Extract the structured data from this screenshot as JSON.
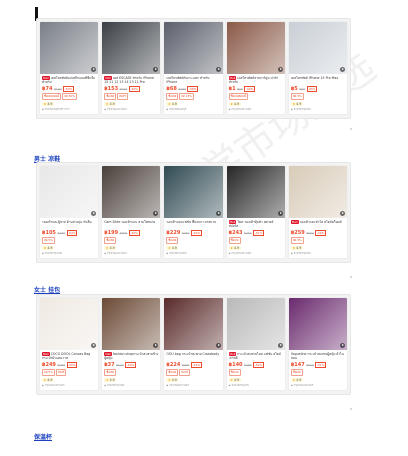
{
  "watermark": "鹏学市场严选",
  "sections": [
    {
      "title": "",
      "items": [
        {
          "title": "เคสโทรศัพท์แม่เหล็กแบบพีซีแข็งสำหรับ",
          "mall": "Mall",
          "price": "฿74",
          "old": "฿199",
          "disc": "-63%",
          "chips": [
            "ซื้อเลยตอนนี้",
            "ลด 50%"
          ],
          "rating": "4.9",
          "location": "จังหวัดสมุทรปราการ",
          "img": "#7a7f87",
          "promo": [
            "orange",
            "red"
          ]
        },
        {
          "title": "เคส ESCASE สำหรับ iPhone 15 11 12 13 14 13 11 Pro",
          "mall": "Mall",
          "price": "฿153",
          "old": "฿299",
          "disc": "-49%",
          "chips": [
            "ซื้อเลย",
            "ส่งฟรี"
          ],
          "rating": "4.9",
          "location": "กรุงเทพมหานคร",
          "img": "#3a3f45",
          "promo": [
            "orange",
            "red"
          ]
        },
        {
          "title": "เคสโทรศัพท์กันกระแทก สำหรับ iPhone",
          "mall": "",
          "price": "฿68",
          "old": "฿160",
          "disc": "-58%",
          "chips": [
            "ซื้อเลย",
            "ลด 15%"
          ],
          "rating": "4.9",
          "location": "จังหวัดนนทบุรี",
          "img": "#5b5f6b",
          "promo": [
            "orange",
            "green"
          ]
        },
        {
          "title": "เคสโทรศัพท์ลายการ์ตูน น่ารัก สำหรับ",
          "mall": "Mall",
          "price": "฿1",
          "old": "฿99",
          "disc": "-99%",
          "chips": [
            "ซื้อเลยตอนนี้"
          ],
          "rating": "4.9",
          "location": "กรุงเทพมหานคร",
          "img": "#8a5a48",
          "promo": [
            "orange",
            "red"
          ]
        },
        {
          "title": "เคสโทรศัพท์ iPhone 15 Pro Max",
          "mall": "",
          "price": "฿5",
          "old": "฿99",
          "disc": "-95%",
          "chips": [
            "ลด 5%"
          ],
          "rating": "4.9",
          "location": "จังหวัดกรุงเทพ",
          "img": "#c9cfd6",
          "promo": [
            "green"
          ]
        }
      ]
    },
    {
      "title": "男士 凉鞋",
      "items": [
        {
          "title": "รองเท้าแตะผู้ชาย ด้านล่างนุ่ม กันลื่น",
          "mall": "",
          "price": "฿105",
          "old": "฿230",
          "disc": "-54%",
          "chips": [
            "ลด 5%"
          ],
          "rating": "4.9",
          "location": "จังหวัดกรุงเทพ",
          "img": "#e8e8e8",
          "promo": [
            "orange"
          ]
        },
        {
          "title": "Cam Slide รองเท้าแตะ สวมใสสบาย",
          "mall": "",
          "price": "฿199",
          "old": "฿390",
          "disc": "-49%",
          "chips": [
            "ซื้อเลย"
          ],
          "rating": "4.9",
          "location": "กรุงเทพมหานคร",
          "img": "#4a403a",
          "promo": []
        },
        {
          "title": "รองเท้าแตะแฟชั่น พื้นหนา เบาสบาย",
          "mall": "",
          "price": "฿229",
          "old": "฿450",
          "disc": "-49%",
          "chips": [
            "ซื้อเลย"
          ],
          "rating": "4.9",
          "location": "จังหวัดกรุงเทพ",
          "img": "#2f4a52",
          "promo": [
            "orange",
            "red"
          ]
        },
        {
          "title": "Tavi รองเท้าหุ้มหัว สตายล์สปอร์ต",
          "mall": "Mall",
          "price": "฿243",
          "old": "฿499",
          "disc": "-51%",
          "chips": [
            "ซื้อเลย"
          ],
          "rating": "4.9",
          "location": "กรุงเทพมหานคร",
          "img": "#262626",
          "promo": [
            "orange",
            "purple"
          ]
        },
        {
          "title": "รองเท้าแตะหัวโต สไตล์คร็อคส์",
          "mall": "Mall",
          "price": "฿259",
          "old": "฿590",
          "disc": "-56%",
          "chips": [
            "ลด 5%"
          ],
          "rating": "4.9",
          "location": "จังหวัดกรุงเทพ",
          "img": "#d8cbb8",
          "promo": []
        }
      ]
    },
    {
      "title": "女士 挂包",
      "items": [
        {
          "title": "COCO DOOL Canvas Bag กระเป๋าผ้าแคนวาส",
          "mall": "Mall",
          "price": "฿249",
          "old": "฿499",
          "disc": "-50%",
          "chips": [
            "ลด 5%",
            "ส่งฟรี"
          ],
          "rating": "4.9",
          "location": "กรุงเทพมหานคร",
          "img": "#efe9e2",
          "promo": [
            "orange",
            "red"
          ]
        },
        {
          "title": "fashion shopกระเป๋าสะพายข้าง ผู้หญิง",
          "mall": "Mall",
          "price": "฿37",
          "old": "฿120",
          "disc": "-69%",
          "chips": [
            "ซื้อเลย"
          ],
          "rating": "4.9",
          "location": "จังหวัดกรุงเทพ",
          "img": "#6b4a35",
          "promo": [
            "orange",
            "red"
          ]
        },
        {
          "title": "OOU bag กระเป๋าสะพาย Crossbody",
          "mall": "",
          "price": "฿224",
          "old": "฿390",
          "disc": "-43%",
          "chips": [
            "ซื้อเลย",
            "ส่งฟรี"
          ],
          "rating": "4.9",
          "location": "กรุงเทพมหานคร",
          "img": "#5a2a2a",
          "promo": [
            "orange",
            "red"
          ]
        },
        {
          "title": "กระเป๋าสะพายไหล่ แฟชั่น สไตล์เกาหลี",
          "mall": "Mall",
          "price": "฿140",
          "old": "฿280",
          "disc": "-50%",
          "chips": [
            "ซื้อเลย"
          ],
          "rating": "4.9",
          "location": "จังหวัดกรุงเทพ",
          "img": "#b9b9b9",
          "promo": []
        },
        {
          "title": "Vogueline กระเป๋าสะพายผู้หญิง ผ้าไนล่อน",
          "mall": "",
          "price": "฿147",
          "old": "฿299",
          "disc": "-51%",
          "chips": [
            "ซื้อเลย"
          ],
          "rating": "4.9",
          "location": "กรุงเทพมหานคร",
          "img": "#6a2a6e",
          "promo": []
        }
      ]
    }
  ],
  "bottom_title": "保温杯",
  "icons": {
    "star": "star-icon",
    "location": "location-pin-icon",
    "play": "play-icon"
  }
}
